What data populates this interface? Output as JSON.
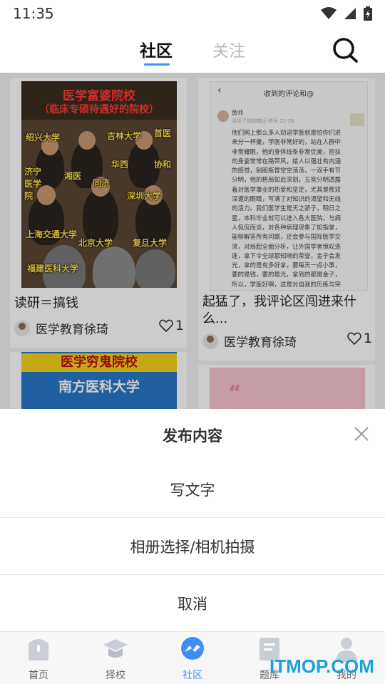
{
  "status_bar": {
    "time": "11:35"
  },
  "top_nav": {
    "tabs": [
      {
        "label": "社区",
        "active": true
      },
      {
        "label": "关注",
        "active": false
      }
    ],
    "search_icon": "search-icon",
    "accent_color": "#3f8ef7"
  },
  "feed": {
    "cards": [
      {
        "title": "读研＝搞钱",
        "author": "医学教育徐琦",
        "likes": "1",
        "poster": {
          "line1": "医学富婆院校",
          "line2": "（临床专硕待遇好的院校）",
          "tags": [
            "首医",
            "吉林大学",
            "绍兴大学",
            "协和",
            "华西",
            "济宁医学院",
            "湘医",
            "同济",
            "深圳大学",
            "上海交通大学",
            "北京大学",
            "复旦大学",
            "福建医科大学"
          ]
        }
      },
      {
        "title": "起猛了，我评论区闯进来什么...",
        "author": "医学教育徐琦",
        "likes": "1",
        "screenshot": {
          "header": "收到的评论和@",
          "name": "黄帅",
          "sub": "评论了你的笔记  昨天 22:26",
          "body": "他们网上那么多人劝退学医就是怕你们进来分一杯羹，学医非常好的，站在人群中非常耀眼，他的身体线条非常优美，担扶的身姿常常在路带风，给人以强壮有内涵的感觉，割胆瓶胃空空荡荡，一双手有节分明，他的格局如此深刻，五官分明透露着对医学事业的热爱和坚定，尤其是那双深邃的眼睛，写满了对知识的渴望和无线的活力。我们医学生是天之骄子，明日之星，本科毕业就可以进入各大医院，与病人侃侃而谈，对各种病理现象了如指掌，能够解答所有问题，还会参与国际医学交流，对局起全面分析，让外国学者惊叹连连，拿下令全球都知晓的荣誉，金子会发光，拿的是有多好拿，要每天一点小事，要的是钱，要的是光，拿到的都是金子，所以，学医好啊，这是对自我的历练与突破，气质显留"
        }
      },
      {
        "poster": {
          "line1": "医学穷鬼院校",
          "line2": "南方医科大学"
        }
      },
      {
        "quote_mark": "“"
      }
    ]
  },
  "sheet": {
    "title": "发布内容",
    "options": [
      "写文字",
      "相册选择/相机拍摄",
      "取消"
    ]
  },
  "tab_bar": {
    "items": [
      {
        "label": "首页",
        "icon": "home-icon",
        "active": false
      },
      {
        "label": "择校",
        "icon": "graduation-cap-icon",
        "active": false
      },
      {
        "label": "社区",
        "icon": "community-icon",
        "active": true
      },
      {
        "label": "题库",
        "icon": "question-bank-icon",
        "active": false
      },
      {
        "label": "我的",
        "icon": "profile-icon",
        "active": false
      }
    ]
  },
  "watermark": "ITMOP.COM"
}
